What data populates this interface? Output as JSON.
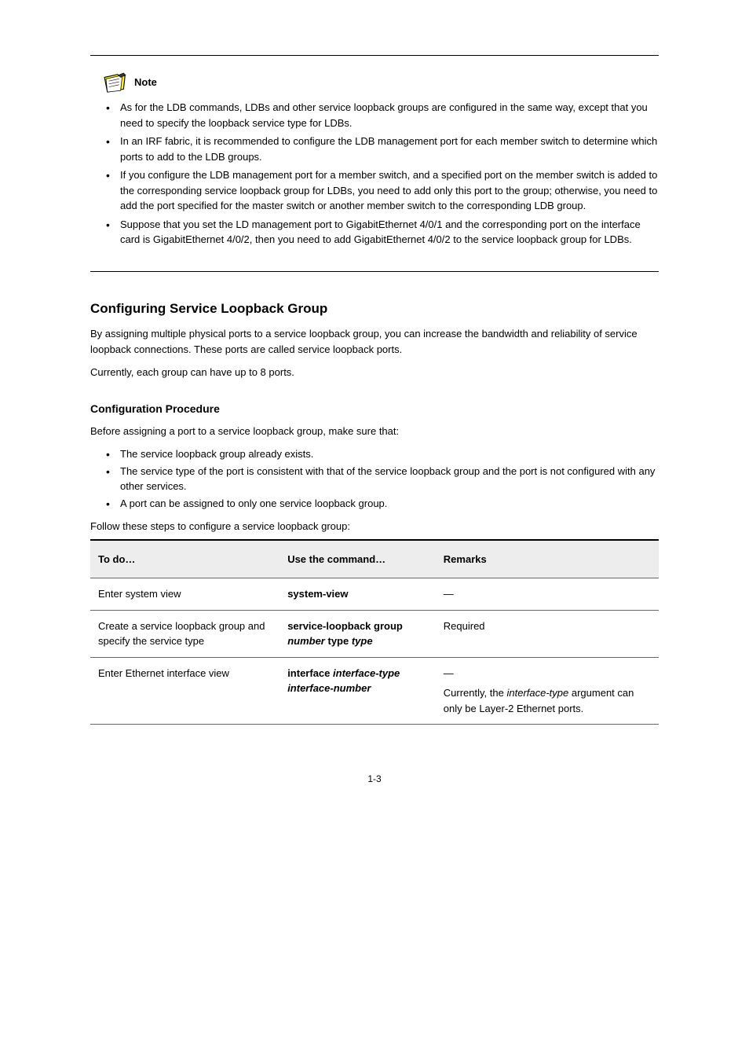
{
  "note": {
    "label": "Note",
    "items": [
      "As for the LDB commands, LDBs and other service loopback groups are configured in the same way, except that you need to specify the loopback service type for LDBs.",
      "In an IRF fabric, it is recommended to configure the LDB management port for each member switch to determine which ports to add to the LDB groups.",
      "If you configure the LDB management port for a member switch, and a specified port on the member switch is added to the corresponding service loopback group for LDBs, you need to add only this port to the group; otherwise, you need to add the port specified for the master switch or another member switch to the corresponding LDB group.",
      "Suppose that you set the LD management port to GigabitEthernet 4/0/1 and the corresponding port on the interface card is GigabitEthernet 4/0/2, then you need to add GigabitEthernet 4/0/2 to the service loopback group for LDBs."
    ]
  },
  "section": {
    "title": "Configuring Service Loopback Group",
    "intro": "By assigning multiple physical ports to a service loopback group, you can increase the bandwidth and reliability of service loopback connections. These ports are called service loopback ports.",
    "intro2": "Currently, each group can have up to 8 ports.",
    "subTitle": "Configuration Procedure",
    "subIntro": "Before assigning a port to a service loopback group, make sure that:",
    "subList": [
      "The service loopback group already exists.",
      "The service type of the port is consistent with that of the service loopback group and the port is not configured with any other services.",
      "A port can be assigned to only one service loopback group."
    ],
    "tableCaption": "Follow these steps to configure a service loopback group:"
  },
  "table": {
    "headers": [
      "To do…",
      "Use the command…",
      "Remarks"
    ],
    "rows": [
      {
        "todo": "Enter system view",
        "cmd": "system-view",
        "remarks": "—"
      },
      {
        "todo": "Create a service loopback group and specify the service type",
        "cmdPrefix": "service-loopback group",
        "cmdItalic1": "number",
        "cmdMid": "type",
        "cmdItalic2": "type",
        "remarks": "Required"
      },
      {
        "todo": "Enter Ethernet interface view",
        "cmdPrefix": "interface",
        "cmdItalic1": "interface-type interface-number",
        "remarksLine1": "—",
        "remarksLine2Prefix": "Currently, the",
        "remarksLine2Italic": "interface-type",
        "remarksLine2Suffix": "argument can only be Layer-2 Ethernet ports."
      }
    ]
  },
  "pageNumber": "1-3"
}
